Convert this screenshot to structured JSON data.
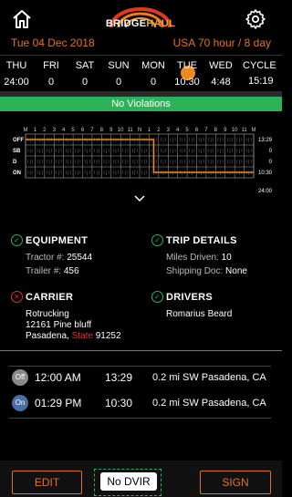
{
  "header": {
    "logo_text_a": "BRIDGE",
    "logo_text_b": "HAUL",
    "date": "Tue 04 Dec 2018",
    "rule": "USA 70 hour / 8 day"
  },
  "days": [
    {
      "label": "THU",
      "value": "24:00"
    },
    {
      "label": "FRI",
      "value": "0"
    },
    {
      "label": "SAT",
      "value": "0"
    },
    {
      "label": "SUN",
      "value": "0"
    },
    {
      "label": "MON",
      "value": "0"
    },
    {
      "label": "TUE",
      "value": "10:30"
    },
    {
      "label": "WED",
      "value": "4:48"
    }
  ],
  "cycle": {
    "label": "CYCLE",
    "value": "15:19"
  },
  "status": "No Violations",
  "graph": {
    "hours": [
      "M",
      "1",
      "2",
      "3",
      "4",
      "5",
      "6",
      "7",
      "8",
      "9",
      "10",
      "11",
      "N",
      "1",
      "2",
      "3",
      "4",
      "5",
      "6",
      "7",
      "8",
      "9",
      "10",
      "11",
      "M"
    ],
    "rows": [
      "OFF",
      "SB",
      "D",
      "ON"
    ],
    "totals": [
      "13:29",
      "0",
      "0",
      "10:30"
    ],
    "grand_total": "24:00"
  },
  "equipment": {
    "title": "EQUIPMENT",
    "tractor_label": "Tractor #:",
    "tractor": "25544",
    "trailer_label": "Trailer #:",
    "trailer": "456"
  },
  "trip": {
    "title": "TRIP DETAILS",
    "miles_label": "Miles Driven:",
    "miles": "10",
    "doc_label": "Shipping Doc:",
    "doc": "None"
  },
  "carrier": {
    "title": "CARRIER",
    "name": "Rotrucking",
    "street": "12161 Pine bluff",
    "city": "Pasadena,",
    "state": "State",
    "zip": "91252"
  },
  "drivers": {
    "title": "DRIVERS",
    "name": "Romarius Beard"
  },
  "events": [
    {
      "badge": "Off",
      "time": "12:00 AM",
      "duration": "13:29",
      "location": "0.2 mi SW Pasadena, CA",
      "color": "#8a8a8a"
    },
    {
      "badge": "On",
      "time": "01:29 PM",
      "duration": "10:30",
      "location": "0.2 mi SW Pasadena, CA",
      "color": "#4a6fa5"
    }
  ],
  "buttons": {
    "edit": "EDIT",
    "dvir": "No DVIR",
    "sign": "SIGN"
  },
  "icons": {
    "home": "home-icon",
    "settings": "gear-icon",
    "expand": "chevron-down-icon"
  }
}
